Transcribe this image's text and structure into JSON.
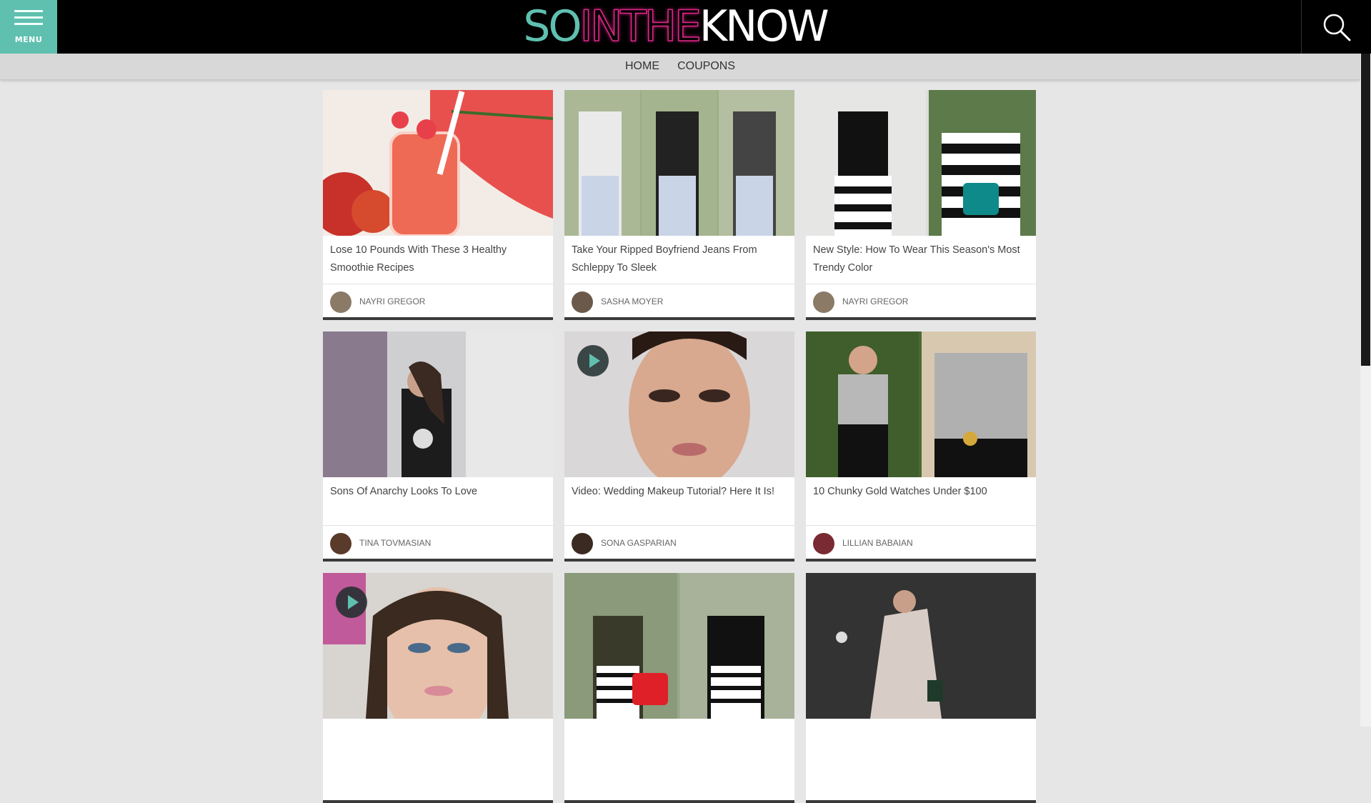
{
  "header": {
    "menu_label": "MENU",
    "logo": {
      "part1": "SO",
      "part2": "INTHE",
      "part3": "KNOW"
    }
  },
  "nav": {
    "items": [
      "HOME",
      "COUPONS"
    ]
  },
  "cards": [
    {
      "title": "Lose 10 Pounds With These 3 Healthy Smoothie Recipes",
      "author": "NAYRI GREGOR"
    },
    {
      "title": "Take Your Ripped Boyfriend Jeans From Schleppy To Sleek",
      "author": "SASHA MOYER"
    },
    {
      "title": "New Style: How To Wear This Season's Most Trendy Color",
      "author": "NAYRI GREGOR"
    },
    {
      "title": "Sons Of Anarchy Looks To Love",
      "author": "TINA TOVMASIAN"
    },
    {
      "title": "Video: Wedding Makeup Tutorial? Here It Is!",
      "author": "SONA GASPARIAN"
    },
    {
      "title": "10 Chunky Gold Watches Under $100",
      "author": "LILLIAN BABAIAN"
    }
  ],
  "colors": {
    "brand_teal": "#5fc0b0",
    "brand_pink": "#e0268a",
    "header_bg": "#000000",
    "page_bg": "#e6e6e6"
  }
}
